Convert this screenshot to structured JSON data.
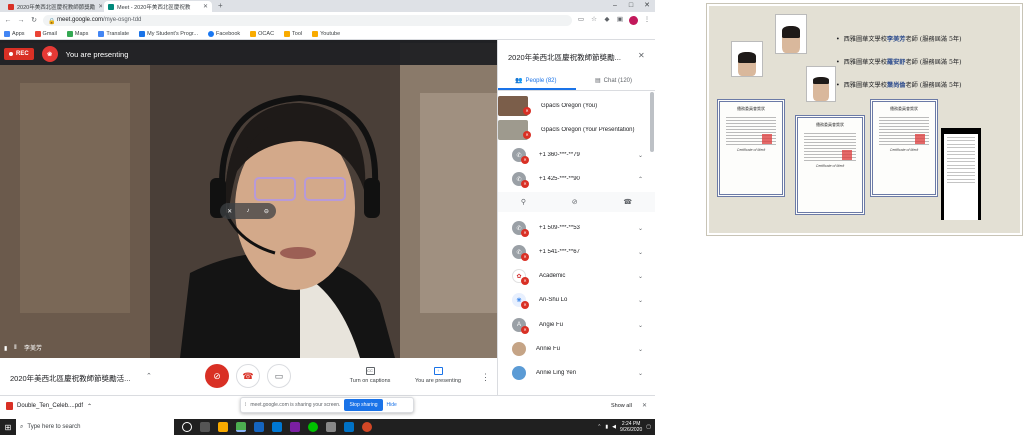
{
  "browser": {
    "tabs": [
      {
        "title": "2020年美西北區慶祝教師節獎勵",
        "color": "#d93025"
      },
      {
        "title": "Meet - 2020年美西北區慶祝教",
        "color": "#00897b"
      }
    ],
    "new_tab": "+",
    "win_controls": [
      "–",
      "□",
      "✕"
    ],
    "url_domain": "meet.google.com",
    "url_path": "/mye-osgn-tdd",
    "bookmarks": [
      {
        "label": "Apps",
        "color": "#4285f4"
      },
      {
        "label": "Gmail",
        "color": "#ea4335"
      },
      {
        "label": "Maps",
        "color": "#34a853"
      },
      {
        "label": "Translate",
        "color": "#4285f4"
      },
      {
        "label": "My Student's Progr...",
        "color": "#1a73e8"
      },
      {
        "label": "Facebook",
        "color": "#1877f2"
      },
      {
        "label": "OCAC",
        "color": "#f9ab00"
      },
      {
        "label": "Tool",
        "color": "#f9ab00"
      },
      {
        "label": "Youtube",
        "color": "#f9ab00"
      }
    ]
  },
  "meet": {
    "rec_label": "REC",
    "presenting_banner": "You are presenting",
    "speaker_name": "李美芳",
    "meeting_name": "2020年美西北區慶祝教師節獎勵活...",
    "controls": {
      "captions_label": "Turn on captions",
      "present_label": "You are presenting"
    }
  },
  "panel": {
    "title": "2020年美西北區慶祝教師節獎勵...",
    "people_tab": "People (82)",
    "chat_tab": "Chat (120)",
    "participants": [
      {
        "name": "Gpacls Oregon (You)",
        "avatar": "photo",
        "letter": ""
      },
      {
        "name": "Gpacls Oregon (Your Presentation)",
        "avatar": "photo",
        "letter": ""
      },
      {
        "name": "+1 360-***-**79",
        "avatar": "phone",
        "letter": "✆"
      },
      {
        "name": "+1 425-***-**90",
        "avatar": "phone",
        "letter": "✆"
      },
      {
        "name": "+1 509-***-**53",
        "avatar": "phone",
        "letter": "✆"
      },
      {
        "name": "+1 541-***-**67",
        "avatar": "phone",
        "letter": "✆"
      },
      {
        "name": "Academic",
        "avatar": "logo",
        "letter": "A"
      },
      {
        "name": "An-Shu Lo",
        "avatar": "logo2",
        "letter": "A"
      },
      {
        "name": "Angie Fu",
        "avatar": "letter",
        "letter": "A"
      },
      {
        "name": "Annie Fu",
        "avatar": "photo2",
        "letter": ""
      },
      {
        "name": "Annie Ling Yen",
        "avatar": "photo3",
        "letter": ""
      }
    ]
  },
  "downloads": {
    "file": "Double_Ten_Celeb....pdf",
    "share_text": "meet.google.com is sharing your screen.",
    "stop_sharing": "Stop sharing",
    "hide": "Hide",
    "show_all": "Show all"
  },
  "taskbar": {
    "search_placeholder": "Type here to search",
    "time": "2:24 PM",
    "date": "9/26/2020"
  },
  "slide": {
    "bullets": [
      {
        "school": "西雅圖華文學校",
        "name": "李美芳",
        "suffix": "老師 (服務屆滿 5年)"
      },
      {
        "school": "西雅圖華文學校",
        "name": "羅安舒",
        "suffix": "老師 (服務屆滿 5年)"
      },
      {
        "school": "西雅圖華文學校",
        "name": "葉尚倫",
        "suffix": "老師 (服務屆滿 5年)"
      }
    ],
    "cert_title": "僑務委員會獎狀",
    "cert_subtitle": "Certificate of Merit",
    "cert_name": "李美芳"
  }
}
